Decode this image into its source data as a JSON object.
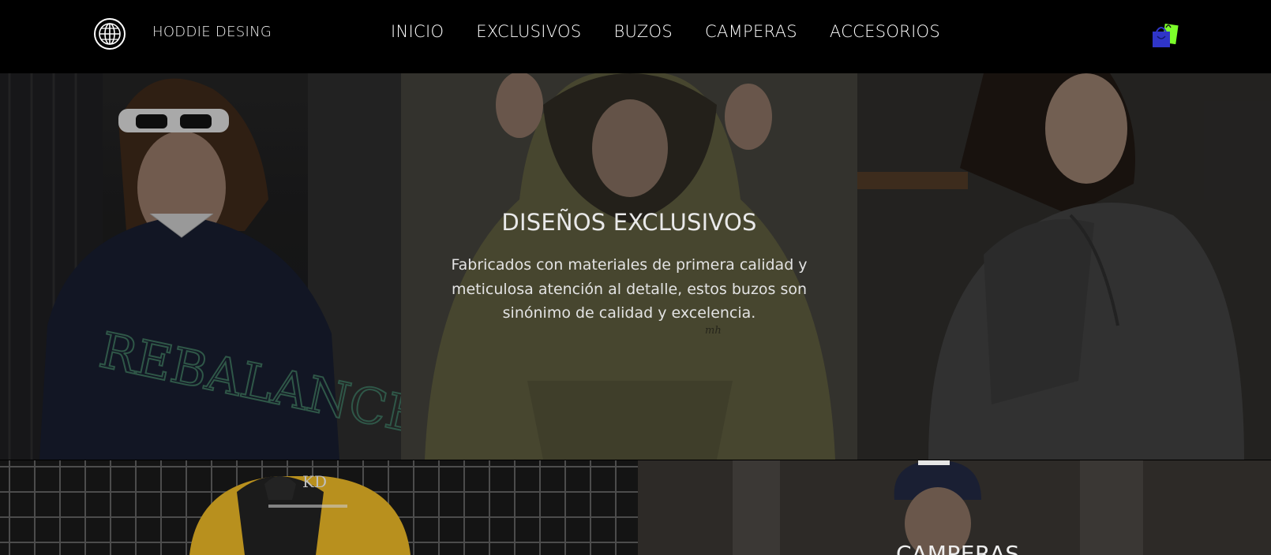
{
  "brand": {
    "name": "HODDIE DESING",
    "logo_icon": "globe-icon"
  },
  "nav": {
    "items": [
      {
        "label": "INICIO"
      },
      {
        "label": "EXCLUSIVOS"
      },
      {
        "label": "BUZOS"
      },
      {
        "label": "CAMPERAS"
      },
      {
        "label": "ACCESORIOS"
      }
    ],
    "cart_icon": "shopping-bag-icon"
  },
  "hero": {
    "title": "DISEÑOS EXCLUSIVOS",
    "description": "Fabricados con materiales de primera calidad y meticulosa atención al detalle, estos buzos son sinónimo de calidad y excelencia.",
    "sweater_text": "REBALANCE",
    "hanger_text": "KD"
  },
  "sections": {
    "camperas_label": "CAMPERAS"
  },
  "colors": {
    "background": "#000000",
    "cart_blue": "#2f35c8",
    "cart_green": "#7cff2a"
  }
}
